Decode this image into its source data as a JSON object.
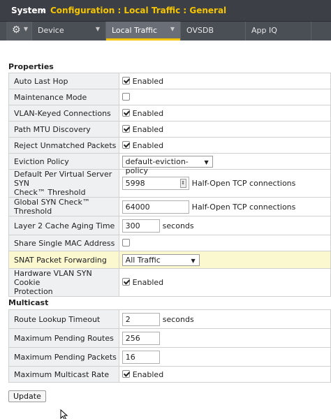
{
  "header": {
    "system": "System",
    "separator": "»",
    "path": "Configuration : Local Traffic : General"
  },
  "tabs": [
    {
      "label": "Device",
      "icon": "chevron-down-icon"
    },
    {
      "label": "Local Traffic",
      "icon": "chevron-down-icon",
      "active": true
    },
    {
      "label": "OVSDB"
    },
    {
      "label": "App IQ"
    }
  ],
  "gear_icon": "gear-icon",
  "properties": {
    "title": "Properties",
    "rows": {
      "auto_last_hop": {
        "label": "Auto Last Hop",
        "checked": true,
        "text": "Enabled"
      },
      "maintenance_mode": {
        "label": "Maintenance Mode",
        "checked": false
      },
      "vlan_keyed": {
        "label": "VLAN-Keyed Connections",
        "checked": true,
        "text": "Enabled"
      },
      "path_mtu": {
        "label": "Path MTU Discovery",
        "checked": true,
        "text": "Enabled"
      },
      "reject_unmatched": {
        "label": "Reject Unmatched Packets",
        "checked": true,
        "text": "Enabled"
      },
      "eviction_policy": {
        "label": "Eviction Policy",
        "value": "default-eviction-policy"
      },
      "default_syn": {
        "label_line1": "Default Per Virtual Server SYN",
        "label_line2": "Check™ Threshold",
        "value": "5998",
        "unit": "Half-Open TCP connections"
      },
      "global_syn": {
        "label": "Global SYN Check™ Threshold",
        "value": "64000",
        "unit": "Half-Open TCP connections"
      },
      "l2_cache": {
        "label": "Layer 2 Cache Aging Time",
        "value": "300",
        "unit": "seconds"
      },
      "single_mac": {
        "label": "Share Single MAC Address",
        "checked": false
      },
      "snat_forwarding": {
        "label": "SNAT Packet Forwarding",
        "value": "All Traffic"
      },
      "hw_vlan_syn": {
        "label_line1": "Hardware VLAN SYN Cookie",
        "label_line2": "Protection",
        "checked": true,
        "text": "Enabled"
      }
    }
  },
  "multicast": {
    "title": "Multicast",
    "rows": {
      "route_lookup": {
        "label": "Route Lookup Timeout",
        "value": "2",
        "unit": "seconds"
      },
      "max_routes": {
        "label": "Maximum Pending Routes",
        "value": "256"
      },
      "max_packets": {
        "label": "Maximum Pending Packets",
        "value": "16"
      },
      "max_rate": {
        "label": "Maximum Multicast Rate",
        "checked": true,
        "text": "Enabled"
      }
    }
  },
  "update_label": "Update",
  "colors": {
    "accent": "#f5c400",
    "header_bg": "#3c4046",
    "highlight": "#fbf7cf"
  }
}
